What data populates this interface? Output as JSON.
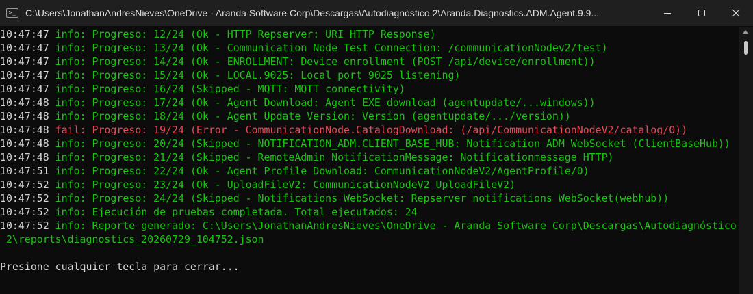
{
  "window": {
    "title": "C:\\Users\\JonathanAndresNieves\\OneDrive - Aranda Software Corp\\Descargas\\Autodiagnóstico 2\\Aranda.Diagnostics.ADM.Agent.9.9...",
    "icon": "terminal-icon",
    "controls": [
      "minimize-icon",
      "maximize-icon",
      "close-icon"
    ]
  },
  "colors": {
    "info": "#16c60c",
    "fail": "#e74856",
    "background": "#0c0c0c",
    "titlebar": "#1f1f1f"
  },
  "console": {
    "lines": [
      {
        "time": "10:47:47",
        "level": "info:",
        "message": "Progreso: 12/24 (Ok - HTTP Repserver: URI HTTP Response)"
      },
      {
        "time": "10:47:47",
        "level": "info:",
        "message": "Progreso: 13/24 (Ok - Communication Node Test Connection: /communicationNodev2/test)"
      },
      {
        "time": "10:47:47",
        "level": "info:",
        "message": "Progreso: 14/24 (Ok - ENROLLMENT: Device enrollment (POST /api/device/enrollment))"
      },
      {
        "time": "10:47:47",
        "level": "info:",
        "message": "Progreso: 15/24 (Ok - LOCAL.9025: Local port 9025 listening)"
      },
      {
        "time": "10:47:47",
        "level": "info:",
        "message": "Progreso: 16/24 (Skipped - MQTT: MQTT connectivity)"
      },
      {
        "time": "10:47:48",
        "level": "info:",
        "message": "Progreso: 17/24 (Ok - Agent Download: Agent EXE download (agentupdate/...windows))"
      },
      {
        "time": "10:47:48",
        "level": "info:",
        "message": "Progreso: 18/24 (Ok - Agent Update Version: Version (agentupdate/.../version))"
      },
      {
        "time": "10:47:48",
        "level": "fail:",
        "message": "Progreso: 19/24 (Error - CommunicationNode.CatalogDownload: (/api/CommunicationNodeV2/catalog/0))"
      },
      {
        "time": "10:47:48",
        "level": "info:",
        "message": "Progreso: 20/24 (Skipped - NOTIFICATION_ADM.CLIENT_BASE_HUB: Notification ADM WebSocket (ClientBaseHub))"
      },
      {
        "time": "10:47:48",
        "level": "info:",
        "message": "Progreso: 21/24 (Skipped - RemoteAdmin NotificationMessage: Notificationmessage HTTP)"
      },
      {
        "time": "10:47:51",
        "level": "info:",
        "message": "Progreso: 22/24 (Ok - Agent Profile Download: CommunicationNodeV2/AgentProfile/0)"
      },
      {
        "time": "10:47:52",
        "level": "info:",
        "message": "Progreso: 23/24 (Ok - UploadFileV2: CommunicationNodeV2 UploadFileV2)"
      },
      {
        "time": "10:47:52",
        "level": "info:",
        "message": "Progreso: 24/24 (Skipped - Notifications WebSocket: Repserver notifications WebSocket(webhub))"
      },
      {
        "time": "10:47:52",
        "level": "info:",
        "message": "Ejecución de pruebas completada. Total ejecutados: 24"
      },
      {
        "time": "10:47:52",
        "level": "info:",
        "message": "Reporte generado: C:\\Users\\JonathanAndresNieves\\OneDrive - Aranda Software Corp\\Descargas\\Autodiagnóstico"
      }
    ],
    "continuation": " 2\\reports\\diagnostics_20260729_104752.json",
    "prompt": "Presione cualquier tecla para cerrar..."
  },
  "scrollbar": {
    "position": 0.0
  }
}
